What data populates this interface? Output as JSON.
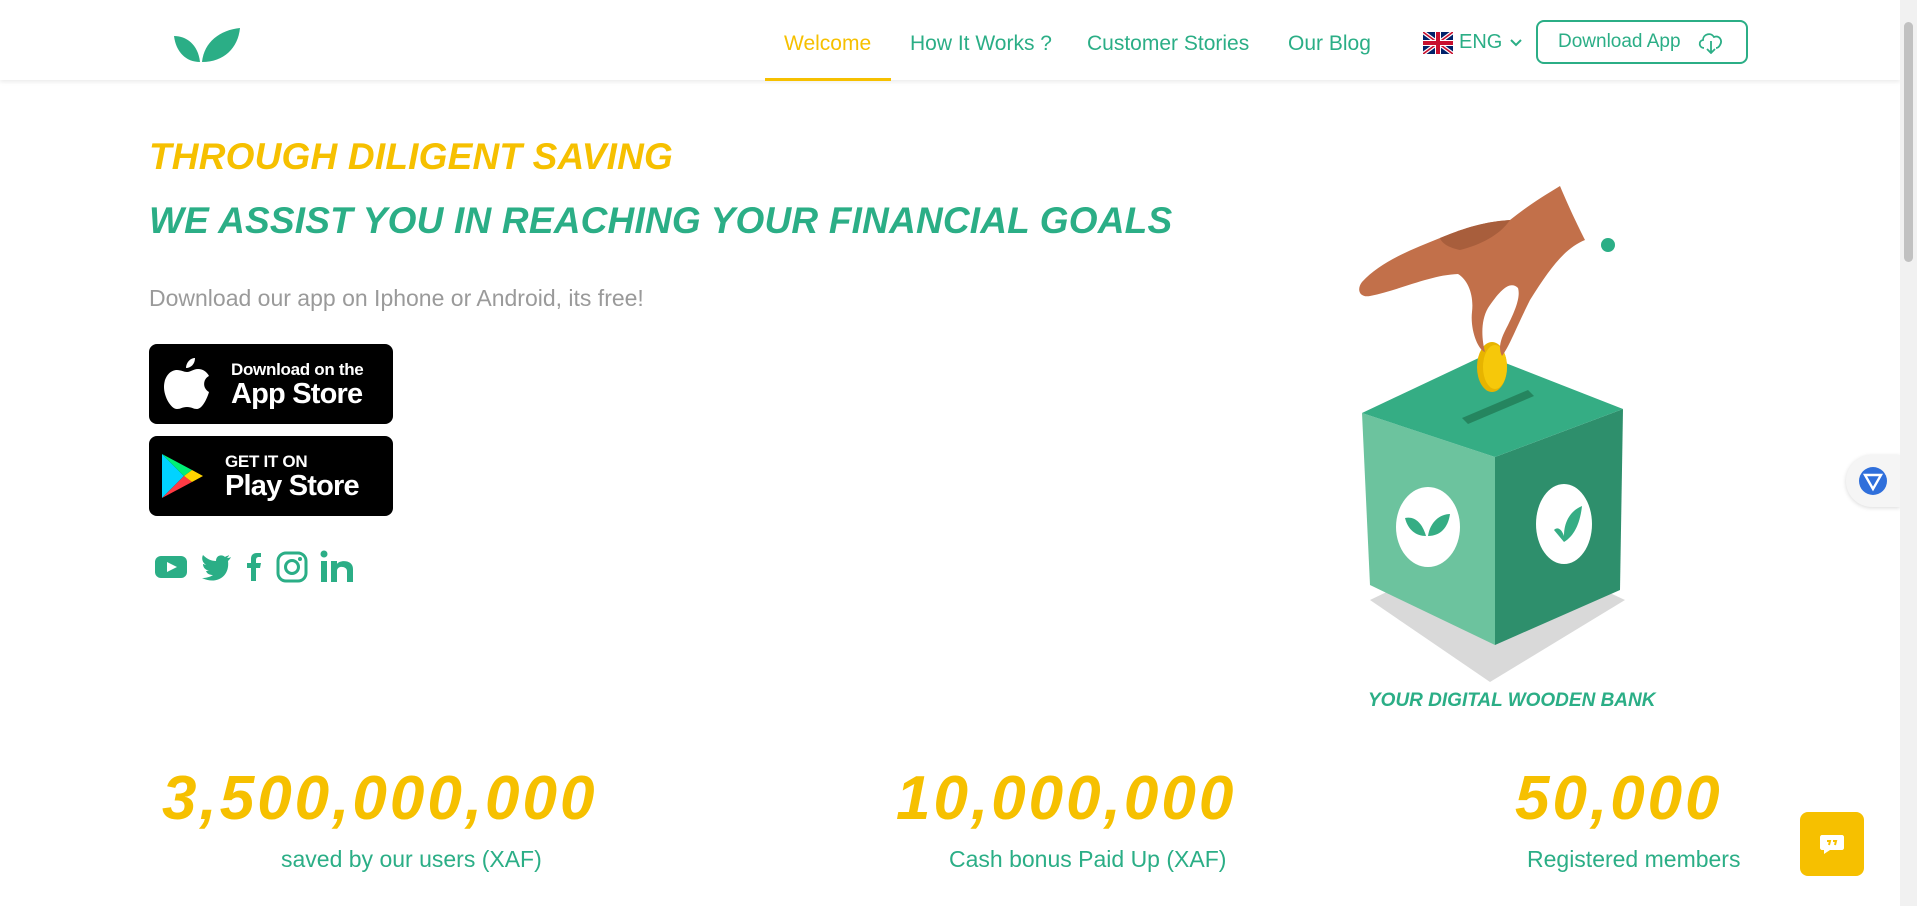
{
  "header": {
    "logo_icon": "leaf-logo-icon",
    "nav": [
      {
        "label": "Welcome",
        "active": true
      },
      {
        "label": "How It Works ?"
      },
      {
        "label": "Customer Stories"
      },
      {
        "label": "Our Blog"
      }
    ],
    "language": {
      "flag_icon": "uk-flag-icon",
      "label": "ENG"
    },
    "download_button": {
      "label": "Download App",
      "icon": "cloud-download-icon"
    }
  },
  "hero": {
    "headline_1": "THROUGH DILIGENT SAVING",
    "headline_2": "WE ASSIST YOU IN REACHING YOUR FINANCIAL GOALS",
    "subtext": "Download our app on Iphone or Android, its free!",
    "app_store": {
      "small": "Download on the",
      "big": "App Store",
      "icon": "apple-icon"
    },
    "play_store": {
      "small": "GET IT ON",
      "big": "Play Store",
      "icon": "google-play-icon"
    },
    "social_icons": [
      "youtube-icon",
      "twitter-icon",
      "facebook-icon",
      "instagram-icon",
      "linkedin-icon"
    ],
    "illustration_caption": "YOUR DIGITAL WOODEN BANK"
  },
  "stats": [
    {
      "value": "3,500,000,000",
      "label": "saved by our users (XAF)"
    },
    {
      "value": "10,000,000",
      "label": "Cash bonus Paid Up (XAF)"
    },
    {
      "value": "50,000",
      "label": "Registered members"
    }
  ],
  "colors": {
    "brand_green": "#2bae86",
    "brand_yellow": "#f6c000"
  }
}
